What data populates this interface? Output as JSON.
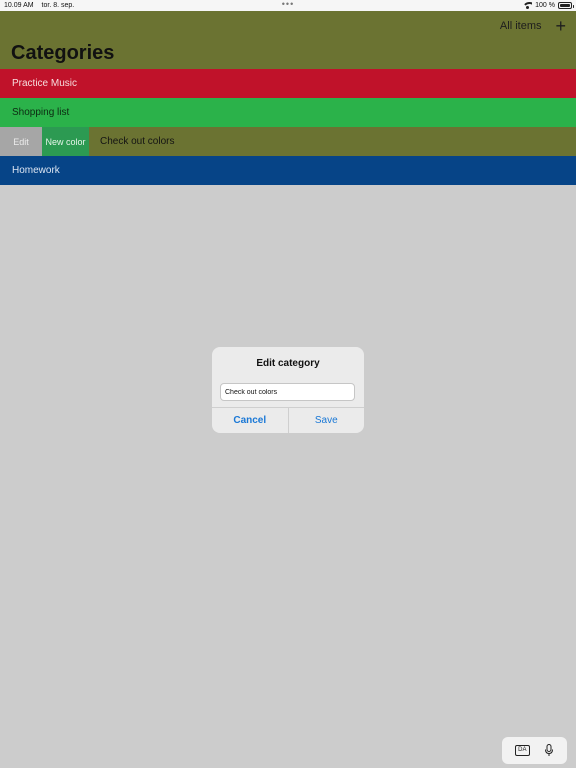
{
  "status_bar": {
    "time": "10.09 AM",
    "date": "tor. 8. sep.",
    "center_dots": "•••",
    "battery": "100 %"
  },
  "navbar": {
    "title": "Categories",
    "all_items_label": "All items",
    "add_icon": "plus-icon",
    "background": "#6b7332"
  },
  "categories": [
    {
      "name": "Practice Music",
      "color": "#c0122a"
    },
    {
      "name": "Shopping list",
      "color": "#2bb24a"
    },
    {
      "name": "Check out colors",
      "color": "#6b7332"
    },
    {
      "name": "Homework",
      "color": "#064487"
    }
  ],
  "swipe_actions": {
    "edit_label": "Edit",
    "new_color_label": "New color"
  },
  "dialog": {
    "title": "Edit category",
    "input_value": "Check out colors",
    "cancel_label": "Cancel",
    "save_label": "Save",
    "accent": "#1a78d6"
  },
  "keyboard_bar": {
    "language_label": "DA",
    "mic_icon": "microphone-icon"
  }
}
